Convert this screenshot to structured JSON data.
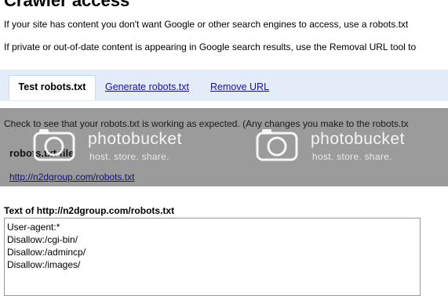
{
  "page": {
    "title": "Crawler access",
    "intro1": "If your site has content you don't want Google or other search engines to access, use a robots.txt",
    "intro2": "If private or out-of-date content is appearing in Google search results, use the Removal URL tool to"
  },
  "tabs": [
    {
      "label": "Test robots.txt",
      "active": true
    },
    {
      "label": "Generate robots.txt",
      "active": false
    },
    {
      "label": "Remove URL",
      "active": false
    }
  ],
  "test": {
    "check_text": "Check to see that your robots.txt is working as expected. (Any changes you make to the robots.tx",
    "robots_label": "robots.txt file",
    "robots_url": "http://n2dgroup.com/robots.txt",
    "text_heading": "Text of http://n2dgroup.com/robots.txt",
    "lines": [
      "User-agent:*",
      "Disallow:/cgi-bin/",
      "Disallow:/admincp/",
      "Disallow:/images/"
    ]
  },
  "watermark": {
    "brand": "photobucket",
    "tagline": "host. store. share."
  },
  "colors": {
    "tabbar_bg": "#e5ecf9",
    "link": "#1a0dab",
    "overlay": "#9b9b9b"
  }
}
